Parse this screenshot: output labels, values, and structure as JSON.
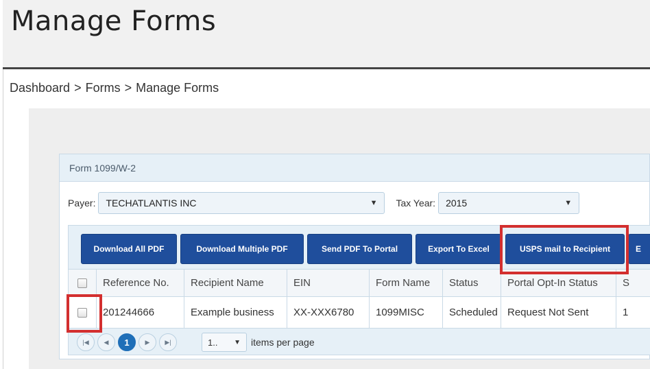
{
  "header": {
    "title": "Manage Forms"
  },
  "breadcrumb": {
    "items": [
      "Dashboard",
      "Forms",
      "Manage Forms"
    ],
    "separator": ">"
  },
  "panel": {
    "title": "Form 1099/W-2",
    "payer_label": "Payer:",
    "payer_value": "TECHATLANTIS INC",
    "tax_year_label": "Tax Year:",
    "tax_year_value": "2015"
  },
  "toolbar": {
    "buttons": [
      "Download All PDF",
      "Download Multiple PDF",
      "Send PDF To Portal",
      "Export To Excel",
      "USPS mail to Recipient",
      "E"
    ]
  },
  "table": {
    "columns": [
      "Reference No.",
      "Recipient Name",
      "EIN",
      "Form Name",
      "Status",
      "Portal Opt-In Status",
      "S"
    ],
    "rows": [
      [
        "201244666",
        "Example business",
        "XX-XXX6780",
        "1099MISC",
        "Scheduled",
        "Request Not Sent",
        "1"
      ]
    ]
  },
  "pager": {
    "current_page": "1",
    "page_size": "1..",
    "items_label": "items per page"
  },
  "colors": {
    "accent": "#1f4e9c",
    "highlight": "#d32f2f",
    "panel_bg": "#e6f0f7"
  },
  "icons": [
    "caret-down-icon",
    "first-page-icon",
    "prev-page-icon",
    "next-page-icon",
    "last-page-icon",
    "checkbox-icon"
  ]
}
